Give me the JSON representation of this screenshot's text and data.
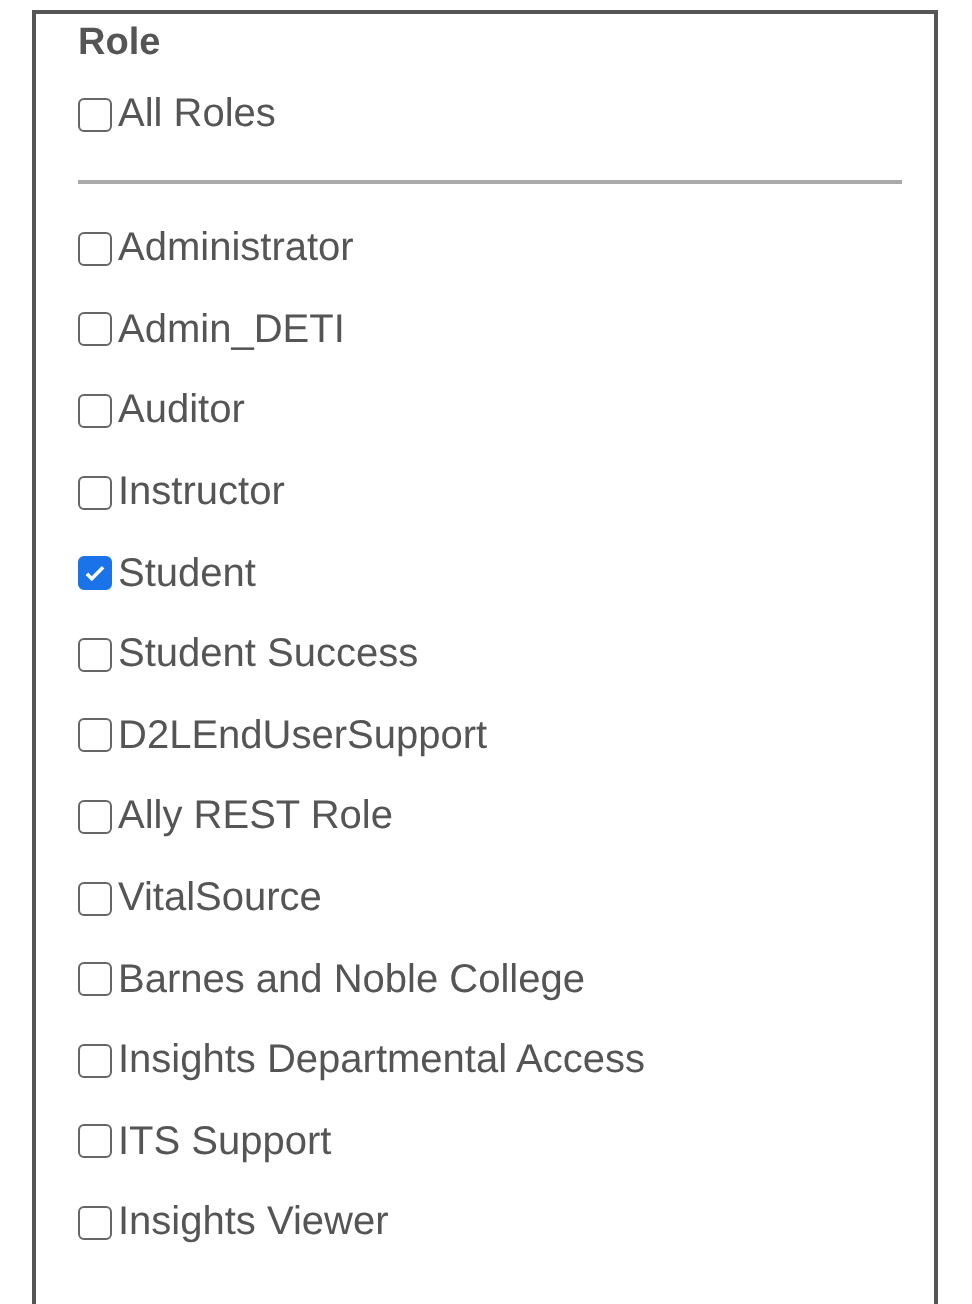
{
  "heading": "Role",
  "all_roles": {
    "label": "All Roles",
    "checked": false
  },
  "roles": [
    {
      "label": "Administrator",
      "checked": false
    },
    {
      "label": "Admin_DETI",
      "checked": false
    },
    {
      "label": "Auditor",
      "checked": false
    },
    {
      "label": "Instructor",
      "checked": false
    },
    {
      "label": "Student",
      "checked": true
    },
    {
      "label": "Student Success",
      "checked": false
    },
    {
      "label": "D2LEndUserSupport",
      "checked": false
    },
    {
      "label": "Ally REST Role",
      "checked": false
    },
    {
      "label": "VitalSource",
      "checked": false
    },
    {
      "label": "Barnes and Noble College",
      "checked": false
    },
    {
      "label": "Insights Departmental Access",
      "checked": false
    },
    {
      "label": "ITS Support",
      "checked": false
    },
    {
      "label": "Insights Viewer",
      "checked": false
    }
  ]
}
